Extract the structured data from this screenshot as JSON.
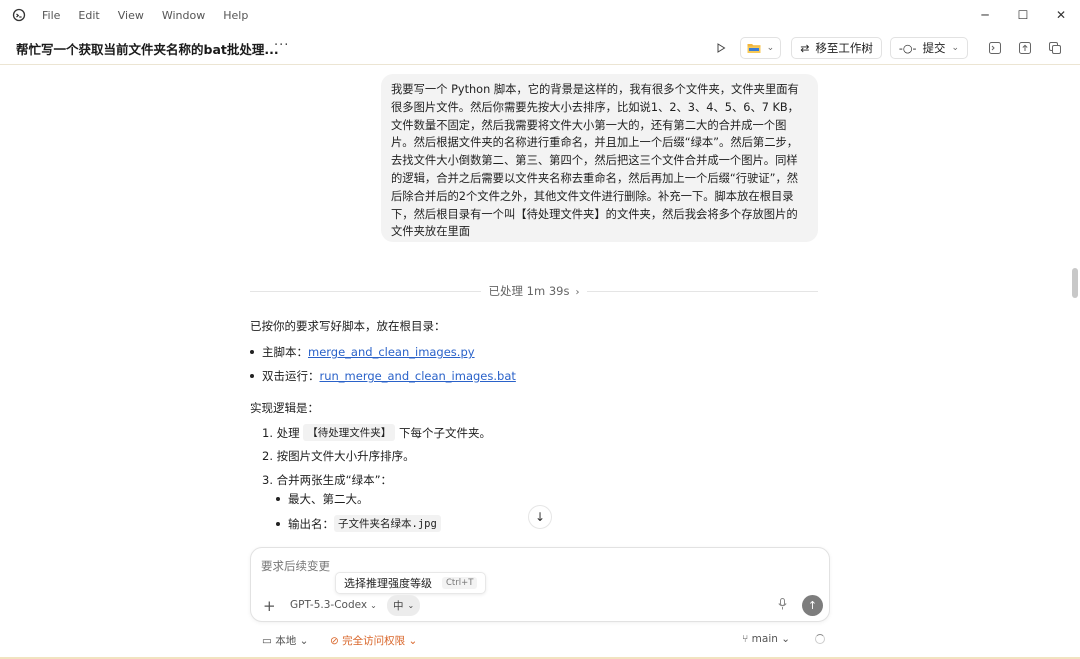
{
  "menubar": {
    "items": [
      "File",
      "Edit",
      "View",
      "Window",
      "Help"
    ],
    "window_controls": [
      "minimize-icon",
      "maximize-icon",
      "close-icon"
    ]
  },
  "header": {
    "title": "帮忙写一个获取当前文件夹名称的bat批处理...",
    "more": "···",
    "move_to_worktree": "移至工作树",
    "commit": "提交"
  },
  "user_message": "我要写一个 Python 脚本，它的背景是这样的，我有很多个文件夹，文件夹里面有很多图片文件。然后你需要先按大小去排序，比如说1、2、3、4、5、6、7 KB，文件数量不固定，然后我需要将文件大小第一大的，还有第二大的合并成一个图片。然后根据文件夹的名称进行重命名，并且加上一个后缀“绿本”。然后第二步，去找文件大小倒数第二、第三、第四个，然后把这三个文件合并成一个图片。同样的逻辑，合并之后需要以文件夹名称去重命名，然后再加上一个后缀“行驶证”，然后除合并后的2个文件之外，其他文件文件进行删除。补充一下。脚本放在根目录下，然后根目录有一个叫【待处理文件夹】的文件夹，然后我会将多个存放图片的文件夹放在里面",
  "processed": {
    "label": "已处理 1m 39s",
    "chevron": "›"
  },
  "reply": {
    "intro": "已按你的要求写好脚本，放在根目录：",
    "main_script_label": "主脚本：",
    "main_script_link": "merge_and_clean_images.py",
    "run_label": "双击运行：",
    "run_link": "run_merge_and_clean_images.bat",
    "logic_heading": "实现逻辑是：",
    "step1_prefix": "1. 处理",
    "step1_code": "【待处理文件夹】",
    "step1_suffix": "下每个子文件夹。",
    "step2": "2. 按图片文件大小升序排序。",
    "step3": "3. 合并两张生成“绿本”：",
    "sub1": "最大、第二大。",
    "sub2_label": "输出名：",
    "sub2_code": "子文件夹名绿本.jpg"
  },
  "composer": {
    "placeholder": "要求后续变更",
    "tooltip": "选择推理强度等级",
    "tooltip_shortcut": "Ctrl+T",
    "model": "GPT-5.3-Codex",
    "effort": "中"
  },
  "footer": {
    "local": "本地",
    "access": "完全访问权限",
    "branch": "main"
  }
}
